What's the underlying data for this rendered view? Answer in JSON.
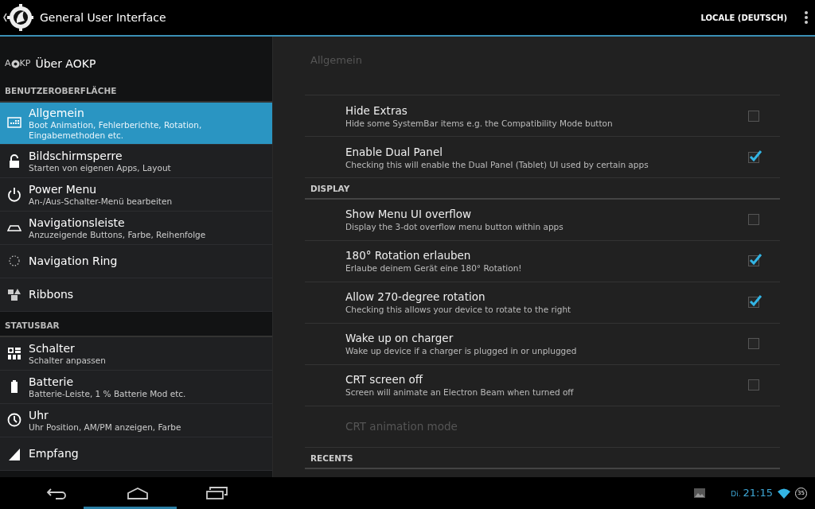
{
  "action_bar": {
    "title": "General User Interface",
    "menu_item": "LOCALE (DEUTSCH)"
  },
  "sidebar": {
    "brand": {
      "left": "A",
      "right": "KP",
      "label": "Über AOKP"
    },
    "items": [
      {
        "kind": "header",
        "title": "BENUTZEROBERFLÄCHE"
      },
      {
        "kind": "item",
        "title": "Allgemein",
        "summary": "Boot Animation, Fehlerberichte, Rotation, Eingabemethoden etc.",
        "selected": true
      },
      {
        "kind": "item",
        "title": "Bildschirmsperre",
        "summary": "Starten von eigenen Apps, Layout",
        "selected": false
      },
      {
        "kind": "item",
        "title": "Power Menu",
        "summary": "An-/Aus-Schalter-Menü bearbeiten",
        "selected": false
      },
      {
        "kind": "item",
        "title": "Navigationsleiste",
        "summary": "Anzuzeigende Buttons, Farbe, Reihenfolge",
        "selected": false
      },
      {
        "kind": "item",
        "title": "Navigation Ring",
        "selected": false
      },
      {
        "kind": "item",
        "title": "Ribbons",
        "selected": false
      },
      {
        "kind": "header",
        "title": "STATUSBAR"
      },
      {
        "kind": "item",
        "title": "Schalter",
        "summary": "Schalter anpassen",
        "selected": false
      },
      {
        "kind": "item",
        "title": "Batterie",
        "summary": "Batterie-Leiste, 1 % Batterie Mod etc.",
        "selected": false
      },
      {
        "kind": "item",
        "title": "Uhr",
        "summary": "Uhr Position, AM/PM anzeigen, Farbe",
        "selected": false
      },
      {
        "kind": "item",
        "title": "Empfang",
        "selected": false
      }
    ]
  },
  "detail": {
    "breadcrumb": "Allgemein",
    "items": [
      {
        "kind": "pref",
        "title": "Hide Extras",
        "summary": "Hide some SystemBar items e.g. the Compatibility Mode button",
        "checked": false
      },
      {
        "kind": "pref",
        "title": "Enable Dual Panel",
        "summary": "Checking this will enable the Dual Panel (Tablet) UI used by certain apps",
        "checked": true
      },
      {
        "kind": "section",
        "title": "DISPLAY"
      },
      {
        "kind": "pref",
        "title": "Show Menu UI overflow",
        "summary": "Display the 3-dot overflow menu button within apps",
        "checked": false
      },
      {
        "kind": "pref",
        "title": "180° Rotation erlauben",
        "summary": "Erlaube deinem Gerät eine 180° Rotation!",
        "checked": true
      },
      {
        "kind": "pref",
        "title": "Allow 270-degree rotation",
        "summary": "Checking this allows your device to rotate to the right",
        "checked": true
      },
      {
        "kind": "pref",
        "title": "Wake up on charger",
        "summary": "Wake up device if a charger is plugged in or unplugged",
        "checked": false
      },
      {
        "kind": "pref",
        "title": "CRT screen off",
        "summary": "Screen will animate an Electron Beam when turned off",
        "checked": false
      },
      {
        "kind": "option",
        "title": "CRT animation mode",
        "disabled": true
      },
      {
        "kind": "section",
        "title": "RECENTS"
      }
    ]
  },
  "system_bar": {
    "day": "Di.",
    "time": "21:15",
    "battery": "35"
  }
}
